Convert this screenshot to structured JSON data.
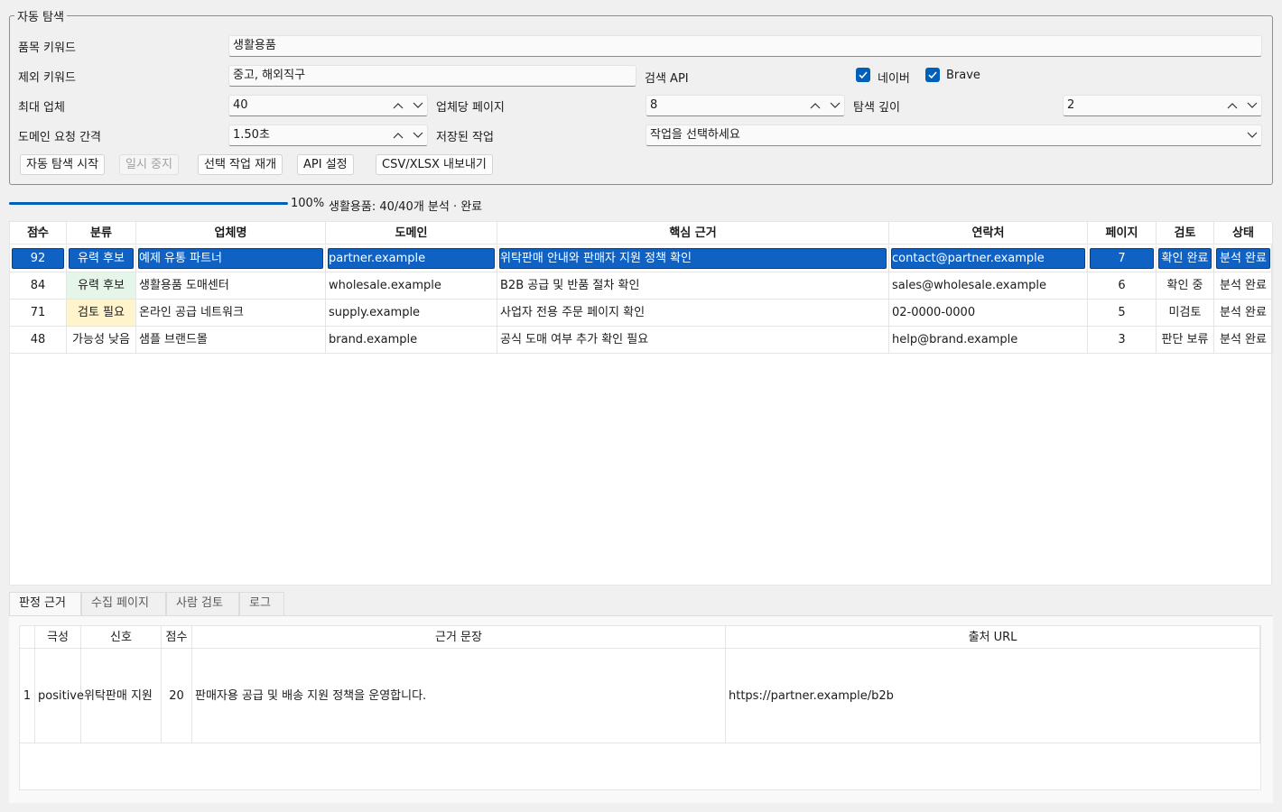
{
  "search_group": {
    "title": "자동 탐색",
    "item_keyword_label": "품목 키워드",
    "item_keyword_value": "생활용품",
    "exclude_keyword_label": "제외 키워드",
    "exclude_keyword_value": "중고, 해외직구",
    "search_api_label": "검색 API",
    "api_naver_label": "네이버",
    "api_naver_checked": true,
    "api_brave_label": "Brave",
    "api_brave_checked": true,
    "max_vendors_label": "최대 업체",
    "max_vendors_value": "40",
    "pages_per_vendor_label": "업체당 페이지",
    "pages_per_vendor_value": "8",
    "search_depth_label": "탐색 깊이",
    "search_depth_value": "2",
    "domain_interval_label": "도메인 요청 간격",
    "domain_interval_value": "1.50초",
    "saved_jobs_label": "저장된 작업",
    "saved_jobs_value": "작업을 선택하세요"
  },
  "buttons": {
    "start": "자동 탐색 시작",
    "pause": "일시 중지",
    "resume": "선택 작업 재개",
    "api_settings": "API 설정",
    "export": "CSV/XLSX 내보내기"
  },
  "progress": {
    "percent_text": "100%",
    "fraction": 1.0,
    "status": "생활용품: 40/40개 분석 · 완료"
  },
  "results_table": {
    "columns": [
      "점수",
      "분류",
      "업체명",
      "도메인",
      "핵심 근거",
      "연락처",
      "페이지",
      "검토",
      "상태"
    ],
    "rows": [
      {
        "score": "92",
        "category": "유력 후보",
        "name": "예제 유통 파트너",
        "domain": "partner.example",
        "evidence": "위탁판매 안내와 판매자 지원 정책 확인",
        "contact": "contact@partner.example",
        "pages": "7",
        "review": "확인 완료",
        "status": "분석 완료"
      },
      {
        "score": "84",
        "category": "유력 후보",
        "name": "생활용품 도매센터",
        "domain": "wholesale.example",
        "evidence": "B2B 공급 및 반품 절차 확인",
        "contact": "sales@wholesale.example",
        "pages": "6",
        "review": "확인 중",
        "status": "분석 완료"
      },
      {
        "score": "71",
        "category": "검토 필요",
        "name": "온라인 공급 네트워크",
        "domain": "supply.example",
        "evidence": "사업자 전용 주문 페이지 확인",
        "contact": "02-0000-0000",
        "pages": "5",
        "review": "미검토",
        "status": "분석 완료"
      },
      {
        "score": "48",
        "category": "가능성 낮음",
        "name": "샘플 브랜드몰",
        "domain": "brand.example",
        "evidence": "공식 도매 여부 추가 확인 필요",
        "contact": "help@brand.example",
        "pages": "3",
        "review": "판단 보류",
        "status": "분석 완료"
      }
    ]
  },
  "category_colors": {
    "유력 후보": "#e6f5e9",
    "검토 필요": "#fff4cc",
    "가능성 낮음": "#ffffff"
  },
  "selection_color": "#0f62c4",
  "tabs": [
    "판정 근거",
    "수집 페이지",
    "사람 검토",
    "로그"
  ],
  "evidence_table": {
    "columns": [
      "극성",
      "신호",
      "점수",
      "근거 문장",
      "출처 URL"
    ],
    "rows": [
      {
        "index": "1",
        "polarity": "positive",
        "signal": "위탁판매 지원",
        "score": "20",
        "sentence": "판매자용 공급 및 배송 지원 정책을 운영합니다.",
        "url": "https://partner.example/b2b"
      }
    ]
  }
}
